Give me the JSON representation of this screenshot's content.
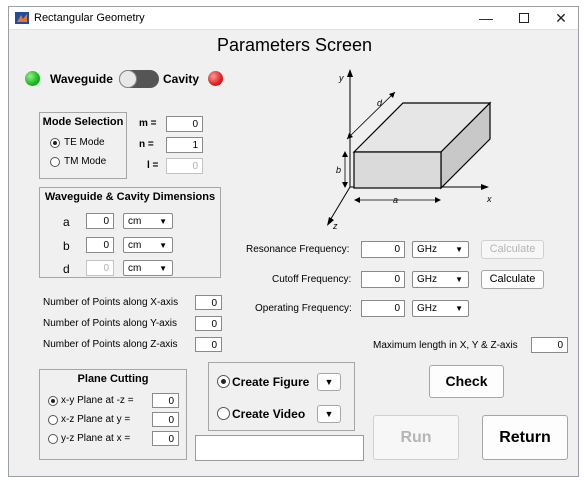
{
  "window": {
    "title": "Rectangular Geometry",
    "minimize": "—",
    "close": "✕"
  },
  "screen_title": "Parameters Screen",
  "toggle": {
    "left_label": "Waveguide",
    "right_label": "Cavity",
    "left_color": "#22c422",
    "right_color": "#e02020"
  },
  "mode_selection": {
    "title": "Mode Selection",
    "options": [
      "TE Mode",
      "TM Mode"
    ],
    "selected": "TE Mode",
    "m_label": "m =",
    "m_value": "0",
    "n_label": "n =",
    "n_value": "1",
    "l_label": "l =",
    "l_value": "0"
  },
  "dimensions": {
    "title": "Waveguide & Cavity Dimensions",
    "rows": [
      {
        "label": "a",
        "value": "0",
        "unit": "cm"
      },
      {
        "label": "b",
        "value": "0",
        "unit": "cm"
      },
      {
        "label": "d",
        "value": "0",
        "unit": "cm"
      }
    ]
  },
  "points": {
    "x_label": "Number of Points along X-axis",
    "x_value": "0",
    "y_label": "Number of Points along Y-axis",
    "y_value": "0",
    "z_label": "Number of Points along Z-axis",
    "z_value": "0"
  },
  "plane_cutting": {
    "title": "Plane Cutting",
    "rows": [
      {
        "label": "x-y Plane at -z =",
        "value": "0"
      },
      {
        "label": "x-z Plane at y =",
        "value": "0"
      },
      {
        "label": "y-z Plane at x =",
        "value": "0"
      }
    ],
    "selected": "x-y Plane at -z ="
  },
  "figure_panel": {
    "create_figure": "Create Figure",
    "create_video": "Create Video",
    "selected": "Create Figure"
  },
  "diagram": {
    "y": "y",
    "x": "x",
    "z": "z",
    "a": "a",
    "b": "b",
    "d": "d"
  },
  "frequencies": {
    "resonance_label": "Resonance Frequency:",
    "resonance_value": "0",
    "resonance_unit": "GHz",
    "cutoff_label": "Cutoff Frequency:",
    "cutoff_value": "0",
    "cutoff_unit": "GHz",
    "operating_label": "Operating Frequency:",
    "operating_value": "0",
    "operating_unit": "GHz",
    "calculate_label": "Calculate"
  },
  "max_length": {
    "label": "Maximum length in X, Y & Z-axis",
    "value": "0"
  },
  "buttons": {
    "check": "Check",
    "run": "Run",
    "return": "Return"
  }
}
